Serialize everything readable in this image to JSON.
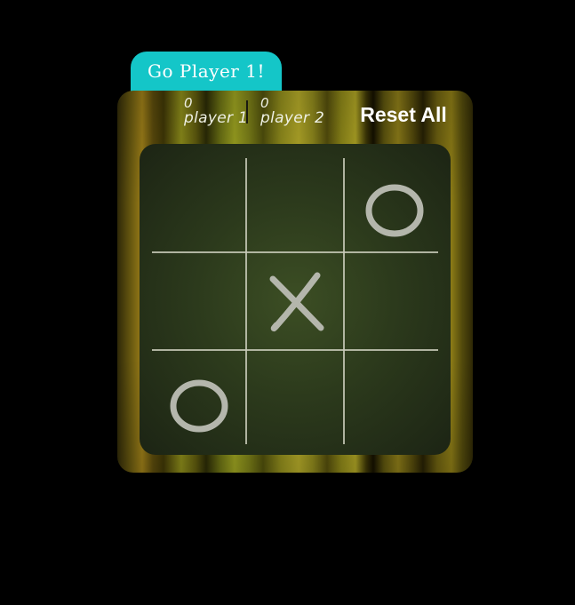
{
  "turn_message": "Go Player 1!",
  "scoreboard": {
    "player1": {
      "score": "0",
      "label": "player 1"
    },
    "player2": {
      "score": "0",
      "label": "player 2"
    }
  },
  "reset_label": "Reset All",
  "board": {
    "cells": [
      "",
      "",
      "O",
      "",
      "X",
      "",
      "O",
      "",
      ""
    ]
  },
  "colors": {
    "turn_tab": "#14c6c8",
    "marks": "#b4b6ac",
    "board": "#2c3a1c"
  }
}
